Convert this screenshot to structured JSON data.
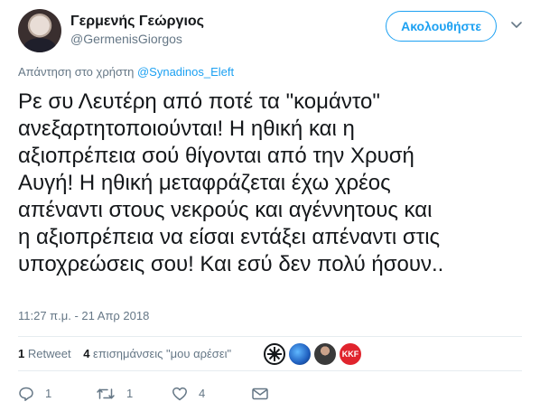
{
  "user": {
    "display_name": "Γερμενής Γεώργιος",
    "handle": "@GermenisGiorgos"
  },
  "follow_button": {
    "label": "Ακολουθήστε"
  },
  "reply_context": {
    "prefix": "Απάντηση στο χρήστη",
    "mention": "@Synadinos_Eleft"
  },
  "tweet": {
    "lines": [
      "Ρε συ Λευτέρη από ποτέ τα \"κομάντο\"",
      "ανεξαρτητοποιούνται! Η ηθική και η",
      "αξιοπρέπεια σού θίγονται από την Χρυσή",
      "Αυγή! Η ηθική μεταφράζεται έχω χρέος",
      "απέναντι στους νεκρούς και αγέννητους και",
      "η αξιοπρέπεια να είσαι εντάξει απέναντι στις",
      "υποχρεώσεις σου! Και εσύ δεν πολύ ήσουν.."
    ],
    "timestamp": "11:27 π.μ. - 21 Απρ 2018"
  },
  "stats": {
    "retweets_count": "1",
    "retweets_label": "Retweet",
    "likes_count": "4",
    "likes_label": "επισημάνσεις \"μου αρέσει\"",
    "liker_badge_text": "KKF"
  },
  "actions": {
    "reply_count": "1",
    "retweet_count": "1",
    "like_count": "4"
  },
  "colors": {
    "accent": "#1da1f2",
    "muted": "#657786",
    "text": "#14171a",
    "divider": "#e6ecf0"
  },
  "icons": [
    "caret-down-icon",
    "reply-icon",
    "retweet-icon",
    "heart-icon",
    "envelope-icon"
  ]
}
